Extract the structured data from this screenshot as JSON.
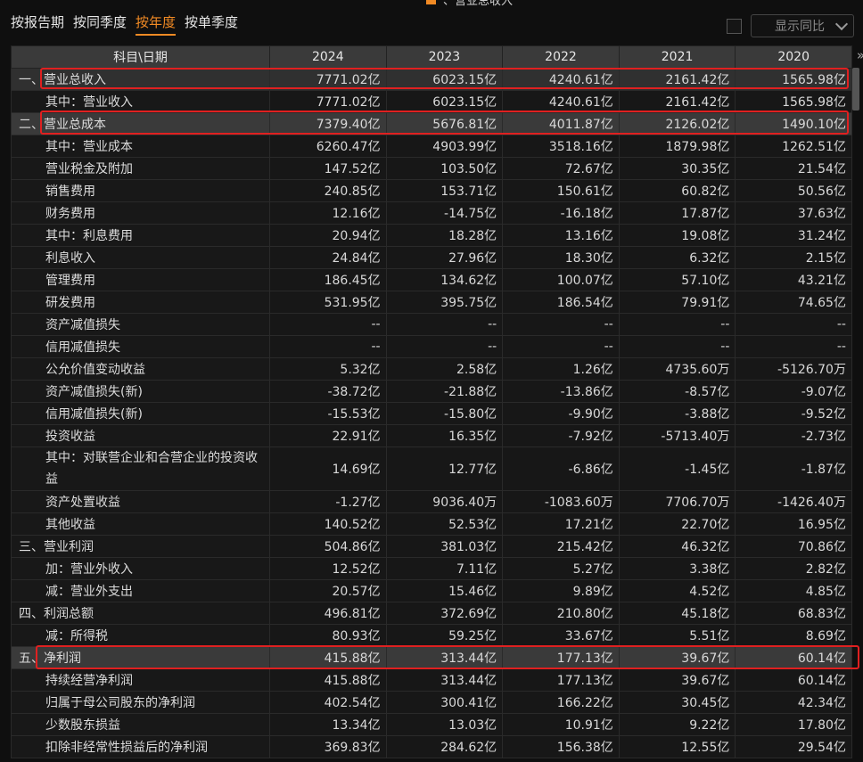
{
  "header": {
    "fragment": "、营业总收入"
  },
  "tabs": [
    {
      "label": "按报告期",
      "active": false
    },
    {
      "label": "按同季度",
      "active": false
    },
    {
      "label": "按年度",
      "active": true
    },
    {
      "label": "按单季度",
      "active": false
    }
  ],
  "tools": {
    "compare_label": "显示同比"
  },
  "table": {
    "header": [
      "科目\\日期",
      "2024",
      "2023",
      "2022",
      "2021",
      "2020"
    ],
    "rows": [
      {
        "name": "一、营业总收入",
        "values": [
          "7771.02亿",
          "6023.15亿",
          "4240.61亿",
          "2161.42亿",
          "1565.98亿"
        ]
      },
      {
        "name": "其中：营业收入",
        "values": [
          "7771.02亿",
          "6023.15亿",
          "4240.61亿",
          "2161.42亿",
          "1565.98亿"
        ]
      },
      {
        "name": "二、营业总成本",
        "values": [
          "7379.40亿",
          "5676.81亿",
          "4011.87亿",
          "2126.02亿",
          "1490.10亿"
        ]
      },
      {
        "name": "其中：营业成本",
        "values": [
          "6260.47亿",
          "4903.99亿",
          "3518.16亿",
          "1879.98亿",
          "1262.51亿"
        ]
      },
      {
        "name": "营业税金及附加",
        "values": [
          "147.52亿",
          "103.50亿",
          "72.67亿",
          "30.35亿",
          "21.54亿"
        ]
      },
      {
        "name": "销售费用",
        "values": [
          "240.85亿",
          "153.71亿",
          "150.61亿",
          "60.82亿",
          "50.56亿"
        ]
      },
      {
        "name": "财务费用",
        "values": [
          "12.16亿",
          "-14.75亿",
          "-16.18亿",
          "17.87亿",
          "37.63亿"
        ]
      },
      {
        "name": "其中：利息费用",
        "values": [
          "20.94亿",
          "18.28亿",
          "13.16亿",
          "19.08亿",
          "31.24亿"
        ]
      },
      {
        "name": "利息收入",
        "values": [
          "24.84亿",
          "27.96亿",
          "18.30亿",
          "6.32亿",
          "2.15亿"
        ]
      },
      {
        "name": "管理费用",
        "values": [
          "186.45亿",
          "134.62亿",
          "100.07亿",
          "57.10亿",
          "43.21亿"
        ]
      },
      {
        "name": "研发费用",
        "values": [
          "531.95亿",
          "395.75亿",
          "186.54亿",
          "79.91亿",
          "74.65亿"
        ]
      },
      {
        "name": "资产减值损失",
        "values": [
          "--",
          "--",
          "--",
          "--",
          "--"
        ]
      },
      {
        "name": "信用减值损失",
        "values": [
          "--",
          "--",
          "--",
          "--",
          "--"
        ]
      },
      {
        "name": "公允价值变动收益",
        "values": [
          "5.32亿",
          "2.58亿",
          "1.26亿",
          "4735.60万",
          "-5126.70万"
        ]
      },
      {
        "name": "资产减值损失(新)",
        "values": [
          "-38.72亿",
          "-21.88亿",
          "-13.86亿",
          "-8.57亿",
          "-9.07亿"
        ]
      },
      {
        "name": "信用减值损失(新)",
        "values": [
          "-15.53亿",
          "-15.80亿",
          "-9.90亿",
          "-3.88亿",
          "-9.52亿"
        ]
      },
      {
        "name": "投资收益",
        "values": [
          "22.91亿",
          "16.35亿",
          "-7.92亿",
          "-5713.40万",
          "-2.73亿"
        ]
      },
      {
        "name": "其中：对联营企业和合营企业的投资收益",
        "values": [
          "14.69亿",
          "12.77亿",
          "-6.86亿",
          "-1.45亿",
          "-1.87亿"
        ]
      },
      {
        "name": "资产处置收益",
        "values": [
          "-1.27亿",
          "9036.40万",
          "-1083.60万",
          "7706.70万",
          "-1426.40万"
        ]
      },
      {
        "name": "其他收益",
        "values": [
          "140.52亿",
          "52.53亿",
          "17.21亿",
          "22.70亿",
          "16.95亿"
        ]
      },
      {
        "name": "三、营业利润",
        "values": [
          "504.86亿",
          "381.03亿",
          "215.42亿",
          "46.32亿",
          "70.86亿"
        ]
      },
      {
        "name": "加：营业外收入",
        "values": [
          "12.52亿",
          "7.11亿",
          "5.27亿",
          "3.38亿",
          "2.82亿"
        ]
      },
      {
        "name": "减：营业外支出",
        "values": [
          "20.57亿",
          "15.46亿",
          "9.89亿",
          "4.52亿",
          "4.85亿"
        ]
      },
      {
        "name": "四、利润总额",
        "values": [
          "496.81亿",
          "372.69亿",
          "210.80亿",
          "45.18亿",
          "68.83亿"
        ]
      },
      {
        "name": "减：所得税",
        "values": [
          "80.93亿",
          "59.25亿",
          "33.67亿",
          "5.51亿",
          "8.69亿"
        ]
      },
      {
        "name": "五、净利润",
        "values": [
          "415.88亿",
          "313.44亿",
          "177.13亿",
          "39.67亿",
          "60.14亿"
        ]
      },
      {
        "name": "持续经营净利润",
        "values": [
          "415.88亿",
          "313.44亿",
          "177.13亿",
          "39.67亿",
          "60.14亿"
        ]
      },
      {
        "name": "归属于母公司股东的净利润",
        "values": [
          "402.54亿",
          "300.41亿",
          "166.22亿",
          "30.45亿",
          "42.34亿"
        ]
      },
      {
        "name": "少数股东损益",
        "values": [
          "13.34亿",
          "13.03亿",
          "10.91亿",
          "9.22亿",
          "17.80亿"
        ]
      },
      {
        "name": "扣除非经常性损益后的净利润",
        "values": [
          "369.83亿",
          "284.62亿",
          "156.38亿",
          "12.55亿",
          "29.54亿"
        ]
      }
    ]
  },
  "icons": {
    "scroll_more": "double-chevron-right-icon"
  },
  "colors": {
    "accent": "#f08a24",
    "highlight_box": "#e02020"
  }
}
